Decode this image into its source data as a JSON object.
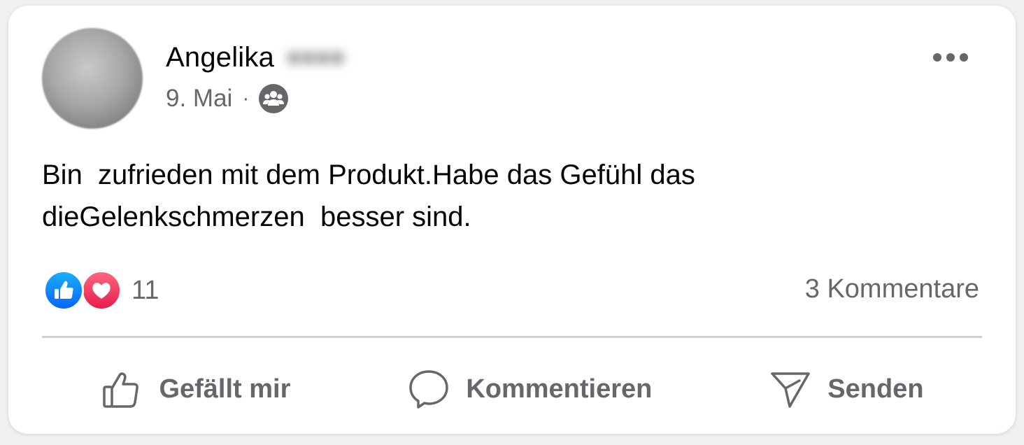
{
  "post": {
    "author_first_name": "Angelika",
    "date": "9. Mai",
    "separator": "·",
    "audience_icon": "group-audience-icon",
    "menu_icon": "more-options-icon",
    "text_line1": "Bin  zufrieden mit dem Produkt.Habe das Gefühl das",
    "text_line2": "dieGelenkschmerzen  besser sind."
  },
  "reactions": {
    "types": [
      "like",
      "love"
    ],
    "count": "11",
    "like_color": "#0866ff",
    "love_color": "#e61e4d"
  },
  "comments": {
    "label": "3 Kommentare"
  },
  "actions": {
    "like_label": "Gefällt mir",
    "comment_label": "Kommentieren",
    "share_label": "Senden"
  }
}
